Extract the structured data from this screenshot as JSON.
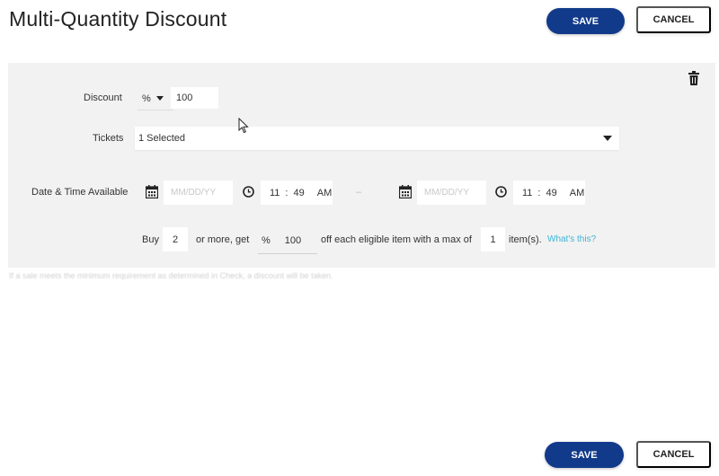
{
  "header": {
    "title": "Multi-Quantity Discount",
    "save_label": "SAVE",
    "cancel_label": "CANCEL"
  },
  "discount": {
    "label": "Discount",
    "unit": "%",
    "value": "100"
  },
  "tickets": {
    "label": "Tickets",
    "selected": "1 Selected"
  },
  "availability": {
    "label": "Date & Time Available",
    "start": {
      "date_placeholder": "MM/DD/YY",
      "hour": "11",
      "minute": "49",
      "ampm": "AM"
    },
    "separator": "–",
    "end": {
      "date_placeholder": "MM/DD/YY",
      "hour": "11",
      "minute": "49",
      "ampm": "AM"
    }
  },
  "rule": {
    "buy_label": "Buy",
    "buy_qty": "2",
    "or_more_label": "or more, get",
    "unit": "%",
    "amount": "100",
    "off_label": "off each eligible item with a max of",
    "max_qty": "1",
    "items_label": "item(s).",
    "help_link": "What's this?"
  },
  "helper_text": "If a sale meets the minimum requirement as determined in Check, a discount will be taken.",
  "footer": {
    "save_label": "SAVE",
    "cancel_label": "CANCEL"
  },
  "colors": {
    "primary": "#123a8a",
    "panel_bg": "#f2f2f2",
    "link": "#3ab6d8"
  }
}
